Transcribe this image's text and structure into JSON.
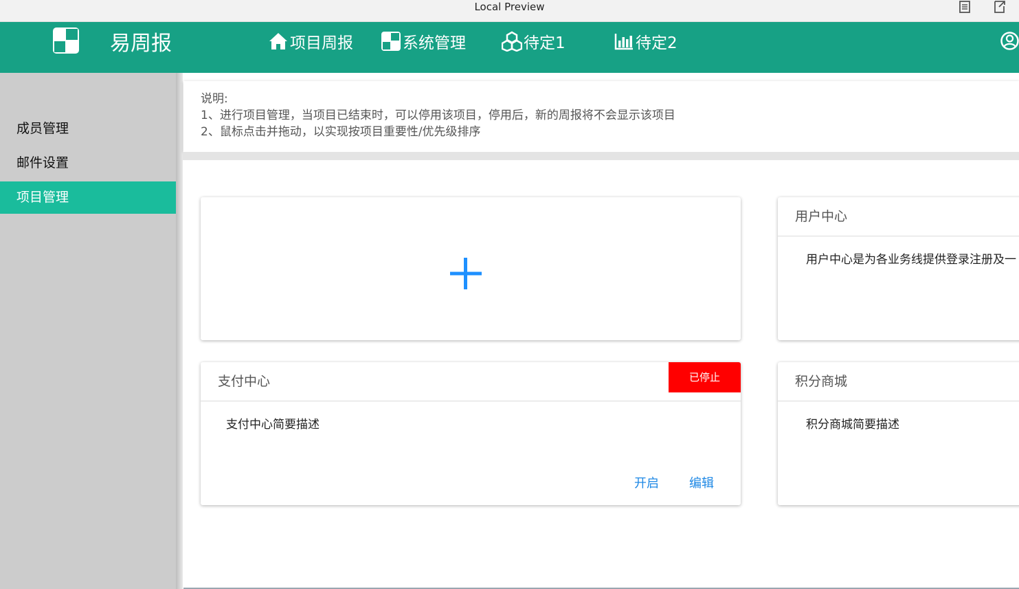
{
  "window": {
    "title": "Local Preview",
    "controls": [
      "reader-mode-icon",
      "exit-preview-icon"
    ]
  },
  "header": {
    "brand": "易周报",
    "logo_icon": "four-square-logo-icon",
    "nav": [
      {
        "label": "项目周报",
        "icon": "home-icon"
      },
      {
        "label": "系统管理",
        "icon": "four-square-icon"
      },
      {
        "label": "待定1",
        "icon": "cubes-icon"
      },
      {
        "label": "待定2",
        "icon": "bar-chart-icon"
      }
    ],
    "user_icon": "user-circle-icon"
  },
  "sidebar": {
    "items": [
      {
        "label": "成员管理",
        "active": false
      },
      {
        "label": "邮件设置",
        "active": false
      },
      {
        "label": "项目管理",
        "active": true
      }
    ]
  },
  "notice": {
    "title": "说明:",
    "lines": [
      "1、进行项目管理，当项目已结束时，可以停用该项目，停用后，新的周报将不会显示该项目",
      "2、鼠标点击并拖动，以实现按项目重要性/优先级排序"
    ]
  },
  "add_card": {
    "icon": "plus-icon"
  },
  "projects": [
    {
      "name": "用户中心",
      "description": "用户中心是为各业务线提供登录注册及一"
    },
    {
      "name": "支付中心",
      "description": "支付中心简要描述",
      "status": "已停止",
      "actions": {
        "enable": "开启",
        "edit": "编辑"
      }
    },
    {
      "name": "积分商城",
      "description": "积分商城简要描述"
    }
  ],
  "colors": {
    "header_bg": "#17a185",
    "sidebar_bg": "#cccccc",
    "sidebar_active": "#1abc9c",
    "stopped_badge": "#ff0000",
    "link": "#1e88e5",
    "plus": "#1e90ff"
  }
}
